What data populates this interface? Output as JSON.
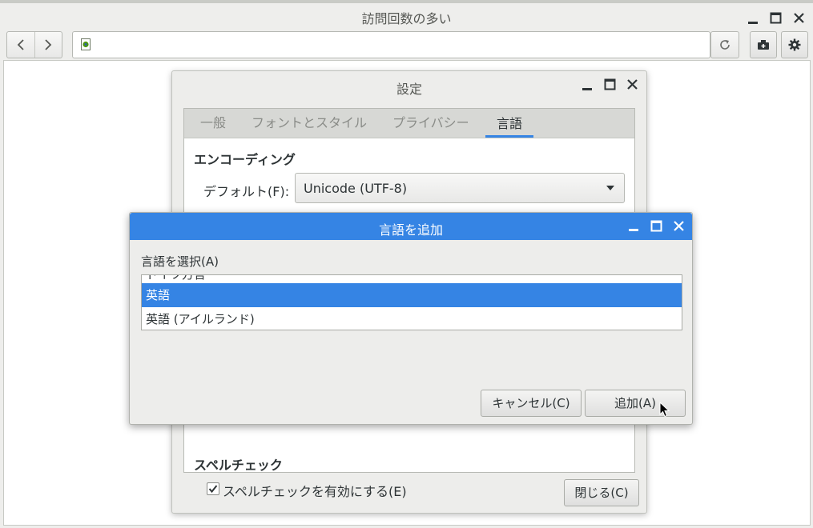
{
  "browser": {
    "title": "訪問回数の多い",
    "url": ""
  },
  "settings": {
    "title": "設定",
    "tabs": [
      {
        "label": "一般"
      },
      {
        "label": "フォントとスタイル"
      },
      {
        "label": "プライバシー"
      },
      {
        "label": "言語"
      }
    ],
    "active_tab": "言語",
    "encoding": {
      "heading": "エンコーディング",
      "default_label": "デフォルト(F):",
      "default_value": "Unicode (UTF-8)"
    },
    "spellcheck": {
      "heading": "スペルチェック",
      "checkbox_label": "スペルチェックを有効にする(E)",
      "checked": true
    },
    "close_label": "閉じる(C)"
  },
  "add_language": {
    "title": "言語を追加",
    "select_label": "言語を選択(A)",
    "items": [
      {
        "label": "ドイツ方言"
      },
      {
        "label": "英語"
      },
      {
        "label": "英語 (アイルランド)"
      }
    ],
    "selected_item": "英語",
    "cancel_label": "キャンセル(C)",
    "add_label": "追加(A)"
  },
  "colors": {
    "accent": "#3584e4",
    "window_bg": "#ededeb",
    "text": "#2e3436"
  }
}
